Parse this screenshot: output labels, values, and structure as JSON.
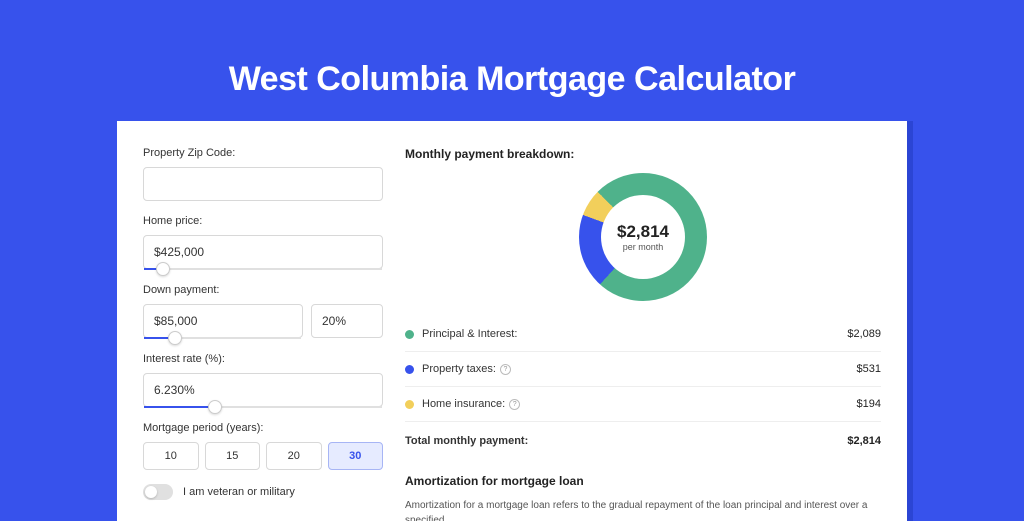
{
  "title": "West Columbia Mortgage Calculator",
  "form": {
    "zip_label": "Property Zip Code:",
    "zip_value": "",
    "home_price_label": "Home price:",
    "home_price": "$425,000",
    "home_price_slider_pct": 8,
    "down_label": "Down payment:",
    "down_amount": "$85,000",
    "down_pct": "20%",
    "down_slider_pct": 20,
    "rate_label": "Interest rate (%):",
    "rate": "6.230%",
    "rate_slider_pct": 30,
    "period_label": "Mortgage period (years):",
    "periods": [
      "10",
      "15",
      "20",
      "30"
    ],
    "period_active_index": 3,
    "veteran_label": "I am veteran or military",
    "veteran": false
  },
  "breakdown": {
    "title": "Monthly payment breakdown:",
    "donut_amount": "$2,814",
    "donut_sub": "per month",
    "items": [
      {
        "label": "Principal & Interest:",
        "value": "$2,089",
        "color": "#4fb28b",
        "info": false
      },
      {
        "label": "Property taxes:",
        "value": "$531",
        "color": "#3752ec",
        "info": true
      },
      {
        "label": "Home insurance:",
        "value": "$194",
        "color": "#f2cf5b",
        "info": true
      }
    ],
    "total_label": "Total monthly payment:",
    "total_value": "$2,814"
  },
  "amort": {
    "title": "Amortization for mortgage loan",
    "text": "Amortization for a mortgage loan refers to the gradual repayment of the loan principal and interest over a specified"
  },
  "colors": {
    "pi": "#4fb28b",
    "tax": "#3752ec",
    "ins": "#f2cf5b"
  },
  "chart_data": {
    "type": "pie",
    "title": "Monthly payment breakdown",
    "categories": [
      "Principal & Interest",
      "Property taxes",
      "Home insurance"
    ],
    "values": [
      2089,
      531,
      194
    ],
    "total": 2814,
    "center_label": "$2,814 per month"
  }
}
